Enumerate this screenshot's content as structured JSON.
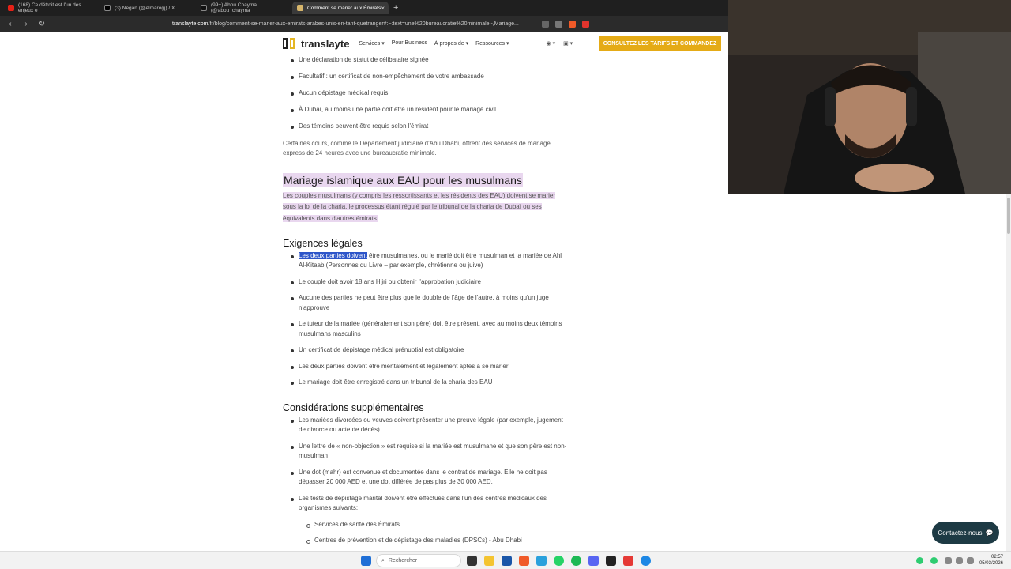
{
  "browser": {
    "tabs": [
      {
        "label": "(168) Ce détroit est l'un des enjeux e",
        "color": "#e62117"
      },
      {
        "label": "(3) Negan (@elmarogj) / X",
        "color": "#000000"
      },
      {
        "label": "(99+) Abou Chayma (@abou_chayma",
        "color": "#111111"
      },
      {
        "label": "Comment se marier aux Émirats",
        "color": "#d6b56b"
      }
    ],
    "close_symbol": "×",
    "new_tab_symbol": "+",
    "url_domain": "translayte.com",
    "url_path": "/fr/blog/comment-se-marier-aux-emirats-arabes-unis-en-tant-quetranger#:~:text=une%20bureaucratie%20minimale.-,Mariage..."
  },
  "site": {
    "logo": "translayte",
    "nav": [
      "Services ▾",
      "Pour Business",
      "À propos de ▾",
      "Ressources ▾"
    ],
    "cta": "CONSULTEZ LES TARIFS ET COMMANDEZ"
  },
  "article": {
    "top_list": [
      "Une déclaration de statut de célibataire signée",
      "Facultatif : un certificat de non-empêchement de votre ambassade",
      "Aucun dépistage médical requis",
      "À Dubaï, au moins une partie doit être un résident pour le mariage civil",
      "Des témoins peuvent être requis selon l'émirat"
    ],
    "paragraph1": "Certaines cours, comme le Département judiciaire d'Abu Dhabi, offrent des services de mariage express de 24 heures avec une bureaucratie minimale.",
    "heading_islamic": "Mariage islamique aux EAU pour les musulmans",
    "paragraph_islamic": "Les couples musulmans (y compris les ressortissants et les résidents des EAU) doivent se marier sous la loi de la charia, le processus étant régulé par le tribunal de la charia de Dubaï ou ses équivalents dans d'autres émirats.",
    "heading_legal": "Exigences légales",
    "legal_first_selected": "Les deux parties doivent",
    "legal_first_rest": " être musulmanes, ou le marié doit être musulman et la mariée de Ahl Al-Kitaab (Personnes du Livre – par exemple, chrétienne ou juive)",
    "legal_list": [
      "Le couple doit avoir 18 ans Hijri ou obtenir l'approbation judiciaire",
      "Aucune des parties ne peut être plus que le double de l'âge de l'autre, à moins qu'un juge n'approuve",
      "Le tuteur de la mariée (généralement son père) doit être présent, avec au moins deux témoins musulmans masculins",
      "Un certificat de dépistage médical prénuptial est obligatoire",
      "Les deux parties doivent être mentalement et légalement aptes à se marier",
      "Le mariage doit être enregistré dans un tribunal de la charia des EAU"
    ],
    "heading_considerations": "Considérations supplémentaires",
    "considerations_list": [
      "Les mariées divorcées ou veuves doivent présenter une preuve légale (par exemple, jugement de divorce ou acte de décès)",
      "Une lettre de « non-objection » est requise si la mariée est musulmane et que son père est non-musulman",
      "Une dot (mahr) est convenue et documentée dans le contrat de mariage. Elle ne doit pas dépasser 20 000 AED et une dot différée de pas plus de 30 000 AED.",
      "Les tests de dépistage marital doivent être effectués dans l'un des centres médicaux des organismes suivants:"
    ],
    "centers_list": [
      "Services de santé des Émirats",
      "Centres de prévention et de dépistage des maladies (DPSCs) - Abu Dhabi"
    ]
  },
  "chat": {
    "label": "Contactez-nous"
  },
  "taskbar": {
    "search_placeholder": "Rechercher",
    "time": "02:57",
    "date": "05/03/2026"
  },
  "colors": {
    "highlight": "#e9d7ef",
    "selection": "#2d55c9",
    "cta": "#e5ab16"
  }
}
